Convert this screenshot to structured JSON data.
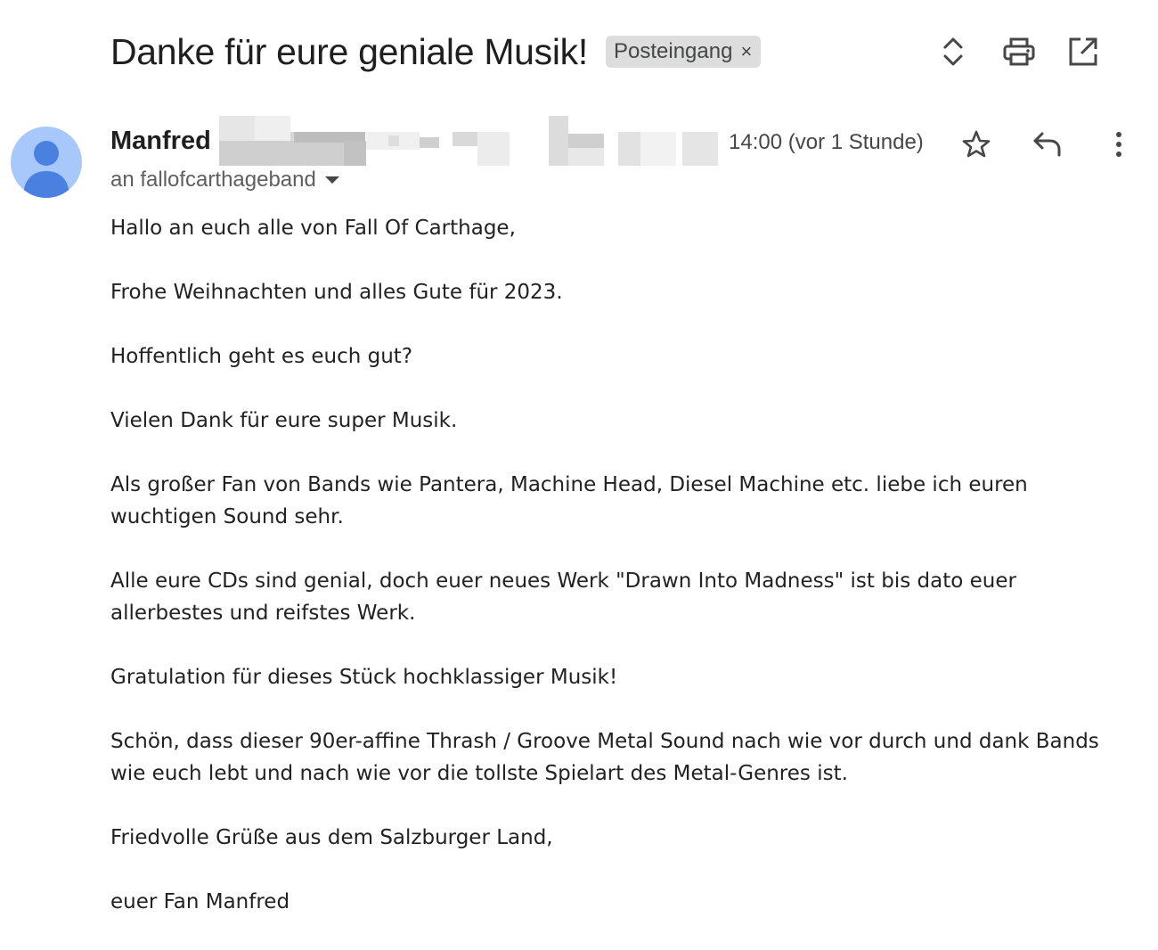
{
  "header": {
    "subject": "Danke für eure geniale Musik!",
    "label": "Posteingang",
    "label_remove": "×",
    "icons": [
      "expand-collapse-icon",
      "print-icon",
      "open-in-new-window-icon"
    ]
  },
  "message": {
    "sender_name": "Manfred",
    "sender_address_redacted": true,
    "timestamp": "14:00 (vor 1 Stunde)",
    "recipient": "an fallofcarthageband",
    "actions": [
      "star-icon",
      "reply-icon",
      "more-vert-icon"
    ],
    "body": [
      "Hallo an euch alle von Fall Of Carthage,",
      "Frohe Weihnachten und alles Gute für 2023.",
      "Hoffentlich geht es euch gut?",
      "Vielen Dank für eure super Musik.",
      "Als großer Fan von Bands wie Pantera, Machine Head, Diesel Machine etc. liebe ich euren wuchtigen Sound sehr.",
      "Alle eure CDs sind genial, doch euer neues Werk \"Drawn Into Madness\" ist bis dato euer allerbestes und reifstes Werk.",
      "Gratulation für dieses Stück hochklassiger Musik!",
      "Schön, dass dieser 90er-affine Thrash / Groove Metal Sound nach wie vor durch und dank Bands wie euch lebt und nach wie vor die tollste Spielart des Metal-Genres ist.",
      "Friedvolle Grüße aus dem Salzburger Land,",
      "euer Fan Manfred"
    ]
  },
  "colors": {
    "avatar_bg": "#a8c7fa",
    "avatar_fg": "#4a80e0",
    "chip_bg": "#dddddd",
    "icon": "#444746"
  }
}
